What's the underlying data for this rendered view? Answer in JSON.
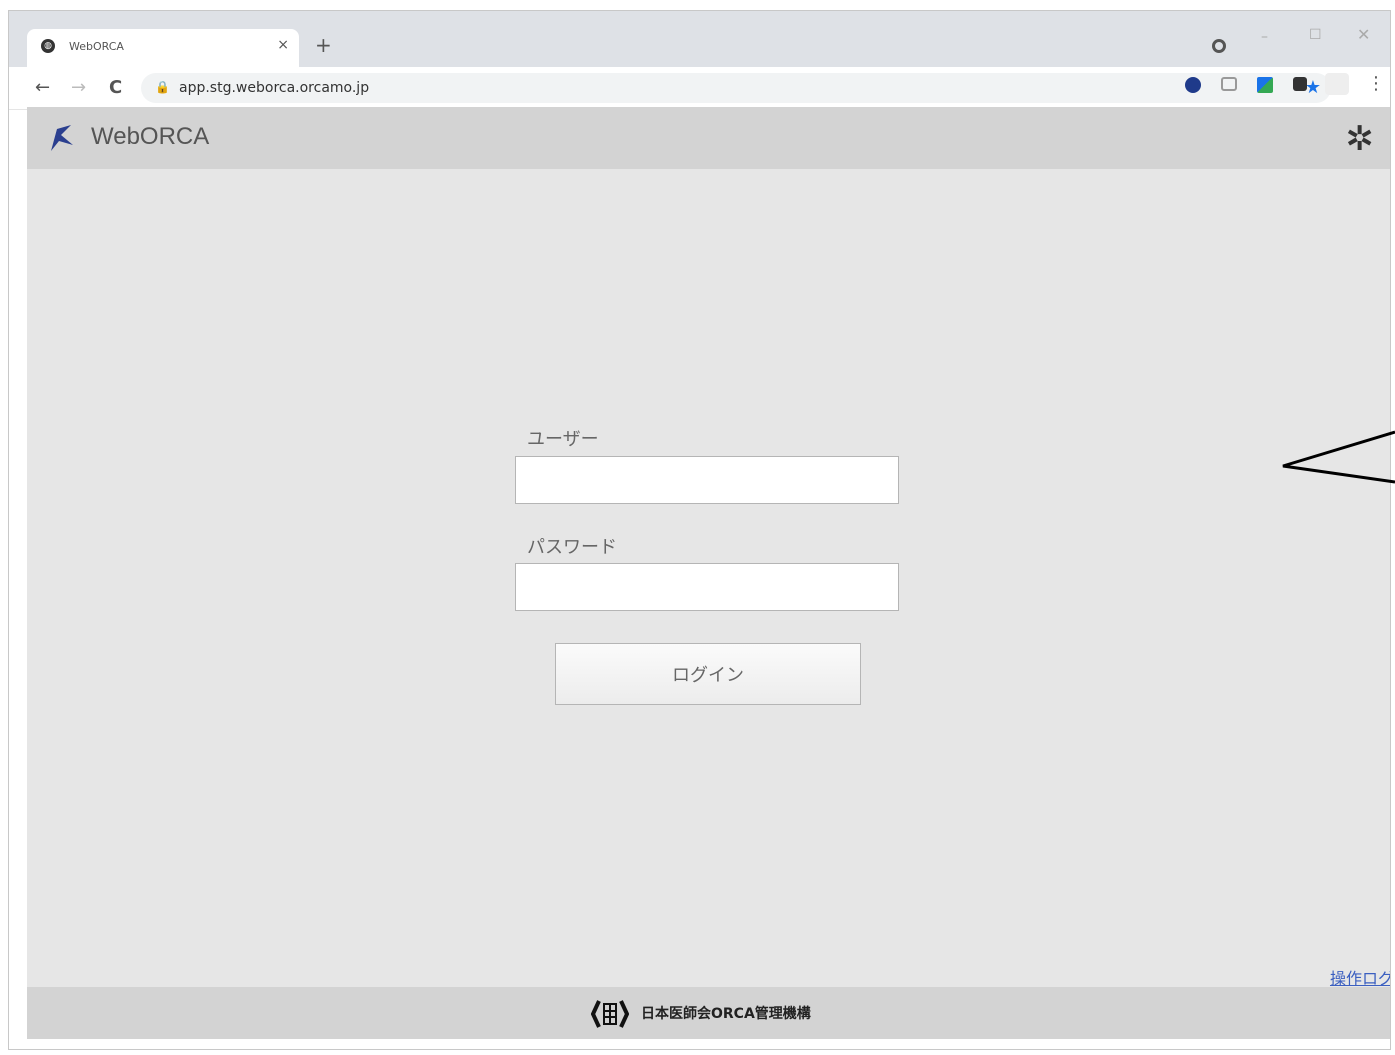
{
  "browser": {
    "tab_title": "WebORCA",
    "tab_close": "×",
    "new_tab": "+",
    "url": "app.stg.weborca.orcamo.jp",
    "nav_back": "←",
    "nav_forward": "→",
    "nav_reload": "C",
    "lock": "🔒",
    "star": "★",
    "menu": "⋮",
    "win_min": "–",
    "win_max": "☐",
    "win_close": "✕"
  },
  "app": {
    "title": "WebORCA",
    "settings_icon": "gear-icon",
    "settings_glyph": "✲"
  },
  "login": {
    "user_label": "ユーザー",
    "password_label": "パスワード",
    "user_value": "",
    "password_value": "",
    "button_label": "ログイン"
  },
  "links": {
    "operation_log": "操作ログ"
  },
  "footer": {
    "org_name": "日本医師会ORCA管理機構"
  },
  "colors": {
    "header_bg": "#d3d3d3",
    "body_bg": "#e6e6e6",
    "link": "#3b5fc0",
    "star": "#1a73e8"
  }
}
